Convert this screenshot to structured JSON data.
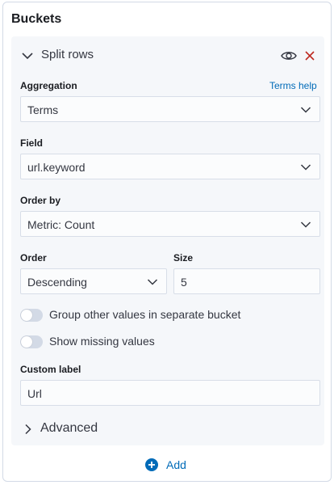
{
  "panel": {
    "title": "Buckets"
  },
  "split": {
    "label": "Split rows",
    "icons": {
      "toggle_visibility": "eye-icon",
      "remove": "close-icon"
    }
  },
  "aggregation": {
    "label": "Aggregation",
    "help_link": "Terms help",
    "value": "Terms"
  },
  "field": {
    "label": "Field",
    "value": "url.keyword"
  },
  "order_by": {
    "label": "Order by",
    "value": "Metric: Count"
  },
  "order": {
    "label": "Order",
    "value": "Descending"
  },
  "size": {
    "label": "Size",
    "value": "5"
  },
  "toggles": {
    "group_other": {
      "label": "Group other values in separate bucket",
      "checked": false
    },
    "show_missing": {
      "label": "Show missing values",
      "checked": false
    }
  },
  "custom_label": {
    "label": "Custom label",
    "value": "Url"
  },
  "advanced": {
    "label": "Advanced"
  },
  "add": {
    "label": "Add"
  },
  "colors": {
    "link": "#006bb8",
    "danger": "#bd271e",
    "toggle_off": "#d3dae6"
  }
}
